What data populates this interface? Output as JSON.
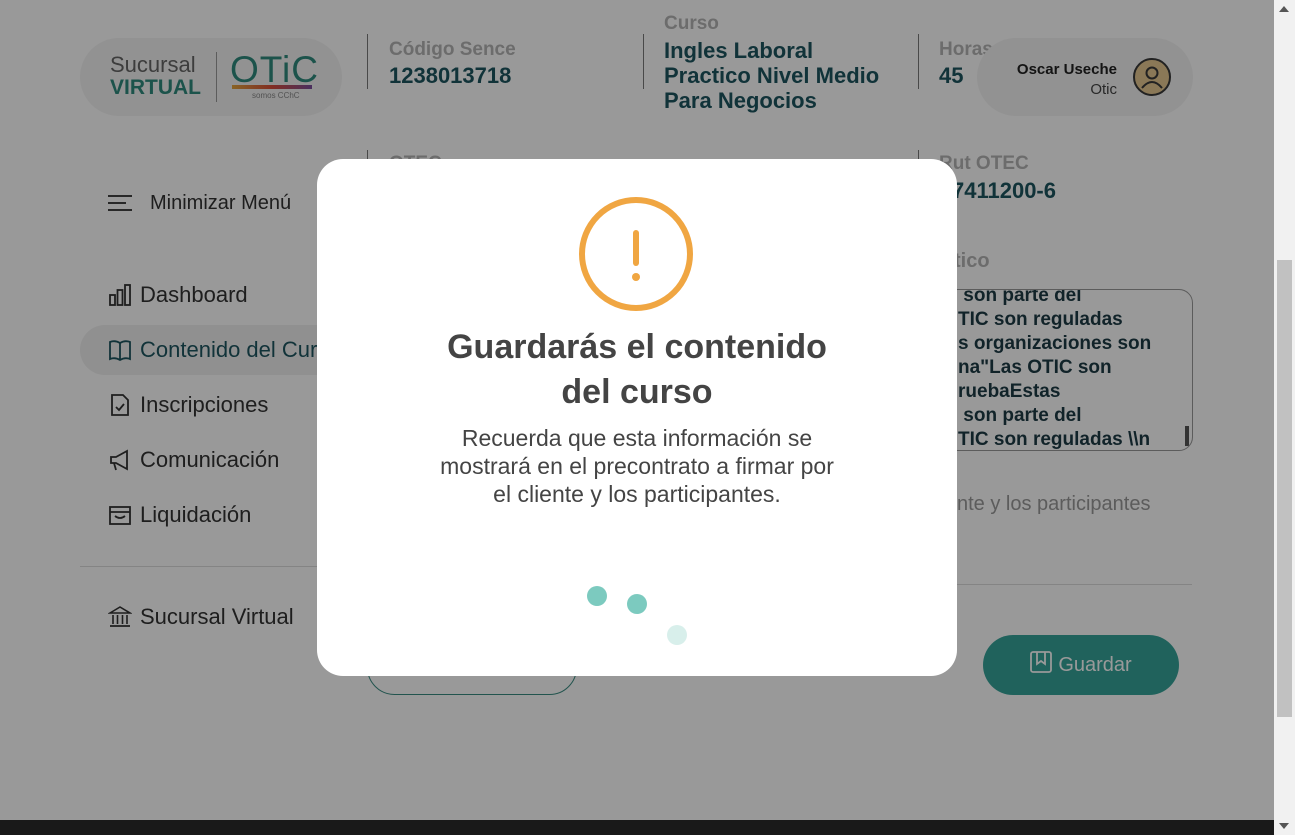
{
  "logo": {
    "sucursal": "Sucursal",
    "virtual": "VIRTUAL",
    "otic": "OTiC",
    "tagline": "somos CChC"
  },
  "course_info": {
    "codigo_label": "Código Sence",
    "codigo_value": "1238013718",
    "curso_label": "Curso",
    "curso_value": "Ingles Laboral Practico Nivel Medio Para Negocios",
    "horas_label": "Horas",
    "horas_value": "45",
    "otec_label": "OTEC",
    "rut_label": "Rut OTEC",
    "rut_value": "7411200-6",
    "tico_label": "tico"
  },
  "user": {
    "name": "Oscar Useche",
    "role": "Otic"
  },
  "sidebar": {
    "toggle_label": "Minimizar Menú",
    "items": [
      {
        "label": "Dashboard",
        "icon": "bar-chart-icon"
      },
      {
        "label": "Contenido del Cur",
        "icon": "book-icon"
      },
      {
        "label": "Inscripciones",
        "icon": "file-check-icon"
      },
      {
        "label": "Comunicación",
        "icon": "megaphone-icon"
      },
      {
        "label": "Liquidación",
        "icon": "wallet-icon"
      }
    ],
    "bottom_item": {
      "label": "Sucursal Virtual",
      "icon": "bank-icon"
    }
  },
  "textarea_content": " son parte del\nTIC son reguladas\ns organizaciones son\nna\"Las OTIC son\nruebaEstas\n son parte del\nTIC son reguladas \\\\n",
  "helper_text": "nte y los participantes",
  "buttons": {
    "guardar": "Guardar"
  },
  "modal": {
    "title": "Guardarás el contenido del curso",
    "message": "Recuerda que esta información se mostrará en el precontrato a firmar por el cliente y los participantes."
  },
  "colors": {
    "accent": "#36a399",
    "brand_dark": "#1d5560",
    "warning": "#f0a642"
  }
}
